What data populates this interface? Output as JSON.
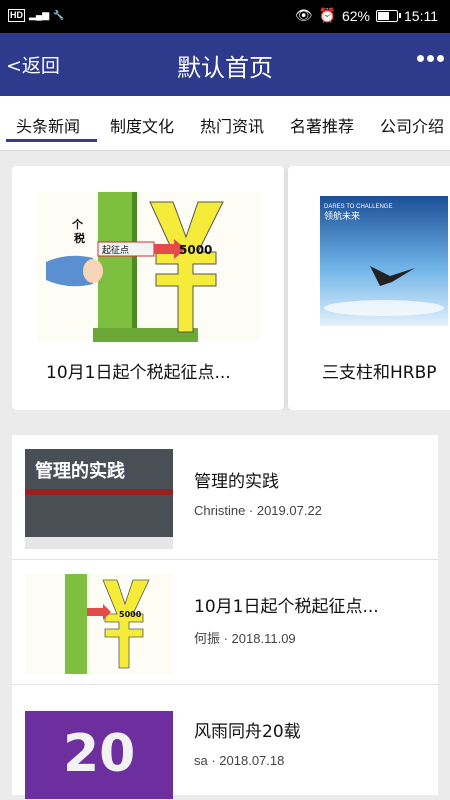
{
  "status_bar": {
    "left": "HD 4G",
    "battery": "62%",
    "time": "15:11",
    "battery_fraction": 0.62
  },
  "navbar": {
    "back": "<返回",
    "title": "默认首页"
  },
  "tabs": [
    "头条新闻",
    "制度文化",
    "热门资讯",
    "名著推荐",
    "公司介绍"
  ],
  "carousel": [
    {
      "title": "10月1日起个税起征点...",
      "image_text": [
        "个",
        "税",
        "起征点",
        "5000"
      ]
    },
    {
      "title": "三支柱和HRBP",
      "image_text": [
        "DARES TO CHALLENGE",
        "领航未来"
      ]
    }
  ],
  "articles": [
    {
      "title": "管理的实践",
      "meta": "Christine · 2019.07.22",
      "image_text": "管理的实践"
    },
    {
      "title": "10月1日起个税起征点...",
      "meta": "何振 · 2018.11.09",
      "image_text": "5000"
    },
    {
      "title": "风雨同舟20载",
      "meta": "sa · 2018.07.18",
      "image_text": "20"
    }
  ]
}
